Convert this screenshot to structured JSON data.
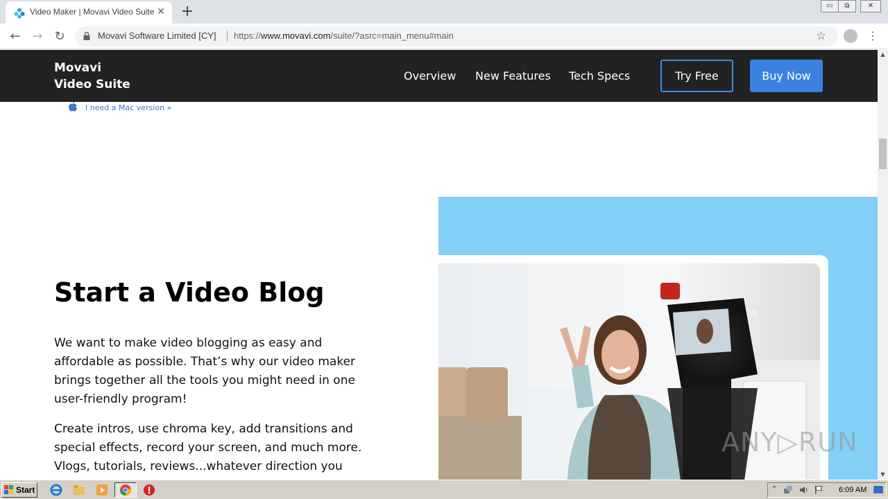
{
  "browser": {
    "tab_title": "Video Maker | Movavi Video Suite",
    "tab_close_glyph": "✕",
    "new_tab_glyph": "+",
    "window_controls": [
      "▭",
      "⧉",
      "✕"
    ],
    "back_glyph": "←",
    "forward_glyph": "→",
    "reload_glyph": "↻",
    "site_identity": "Movavi Software Limited [CY]",
    "url_scheme": "https://",
    "url_host": "www.movavi.com",
    "url_path": "/suite/?asrc=main_menu#main",
    "bookmark_glyph": "☆",
    "menu_glyph": "⋮"
  },
  "header": {
    "brand_line1": "Movavi",
    "brand_line2": "Video Suite",
    "nav": [
      "Overview",
      "New Features",
      "Tech Specs"
    ],
    "try_label": "Try Free",
    "buy_label": "Buy Now"
  },
  "mac_link": "I need a Mac version »",
  "section": {
    "heading": "Start a Video Blog",
    "para1": "We want to make video blogging as easy and affordable as possible. That’s why our video maker brings together all the tools you might need in one user-friendly program!",
    "para2": "Create intros, use chroma key, add transitions and special effects, record your screen, and much more. Vlogs, tutorials, reviews...whatever direction you"
  },
  "watermark": "ANY▷RUN",
  "taskbar": {
    "start_label": "Start",
    "clock": "6:09 AM",
    "tray_up_glyph": "⌃"
  },
  "colors": {
    "header_bg": "#222222",
    "accent_blue": "#3b82e0",
    "panel_blue": "#82d0f6",
    "link_blue": "#3a7bc8"
  }
}
